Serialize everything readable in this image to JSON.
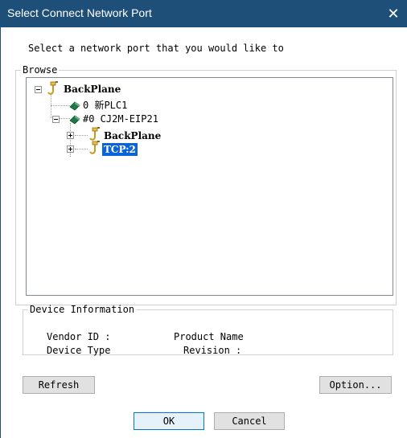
{
  "window": {
    "title": "Select Connect Network Port",
    "close_glyph": "✕"
  },
  "prompt": "Select a network port that you would like to",
  "browse": {
    "label": "Browse",
    "tree": {
      "root": "BackPlane",
      "plc1": "0 新PLC1",
      "eip": "#0 CJ2M-EIP21",
      "backplane2": "BackPlane",
      "tcp": "TCP:2"
    }
  },
  "device_info": {
    "label": "Device Information",
    "vendor_id": "Vendor ID :",
    "product_name": "Product Name",
    "device_type": "Device Type",
    "revision": "Revision :"
  },
  "buttons": {
    "refresh": "Refresh",
    "option": "Option...",
    "ok": "OK",
    "cancel": "Cancel"
  },
  "colors": {
    "title_bg": "#1e4f78",
    "selection": "#0a64d8",
    "plc_icon": "#1f7a4a",
    "port_icon": "#c89b1e"
  },
  "icons": [
    "port-icon",
    "plc-module-icon",
    "close-icon",
    "expand-icon",
    "collapse-icon"
  ]
}
